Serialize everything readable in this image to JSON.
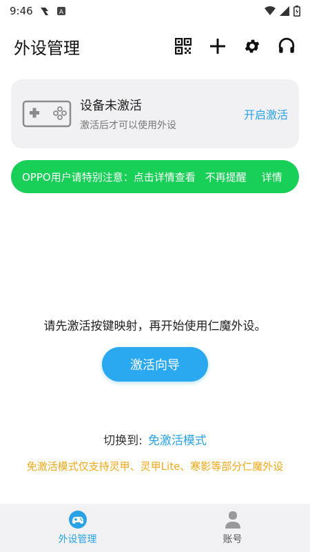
{
  "status_bar": {
    "time": "9:46"
  },
  "header": {
    "title": "外设管理"
  },
  "device_card": {
    "title": "设备未激活",
    "subtitle": "激活后才可以使用外设",
    "action": "开启激活"
  },
  "notice": {
    "text": "OPPO用户请特别注意：点击详情查看",
    "dismiss": "不再提醒",
    "detail": "详情"
  },
  "main": {
    "prompt": "请先激活按键映射，再开始使用仁魔外设。",
    "guide_button": "激活向导"
  },
  "switch": {
    "label": "切换到:",
    "link": "免激活模式",
    "note": "免激活模式仅支持灵甲、灵甲Lite、寒影等部分仁魔外设"
  },
  "bottom_nav": {
    "items": [
      {
        "label": "外设管理",
        "icon": "gamepad-icon",
        "active": true
      },
      {
        "label": "账号",
        "icon": "user-icon",
        "active": false
      }
    ]
  },
  "colors": {
    "accent": "#2aa3e6",
    "button": "#2aa9f0",
    "banner": "#18cf57",
    "warning": "#f0a81a"
  }
}
